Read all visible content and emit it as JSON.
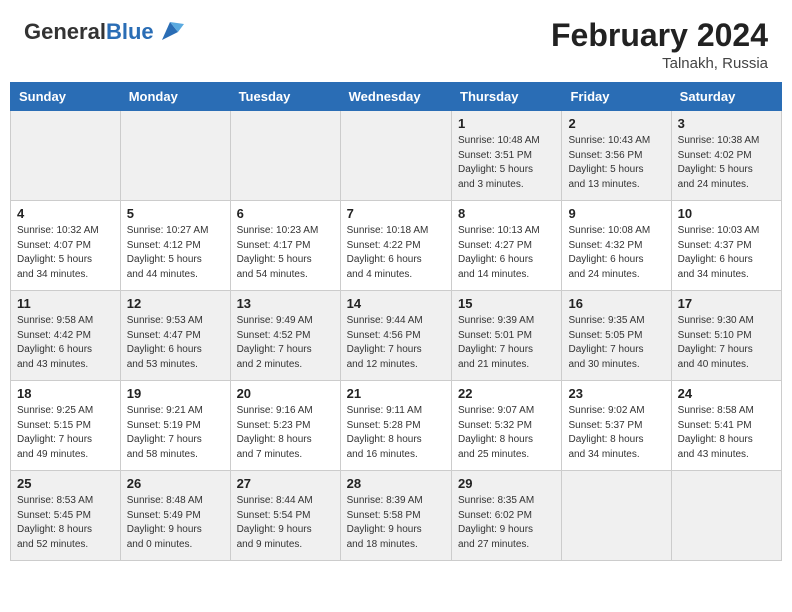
{
  "header": {
    "logo_general": "General",
    "logo_blue": "Blue",
    "month_year": "February 2024",
    "location": "Talnakh, Russia"
  },
  "weekdays": [
    "Sunday",
    "Monday",
    "Tuesday",
    "Wednesday",
    "Thursday",
    "Friday",
    "Saturday"
  ],
  "weeks": [
    [
      {
        "day": "",
        "info": ""
      },
      {
        "day": "",
        "info": ""
      },
      {
        "day": "",
        "info": ""
      },
      {
        "day": "",
        "info": ""
      },
      {
        "day": "1",
        "info": "Sunrise: 10:48 AM\nSunset: 3:51 PM\nDaylight: 5 hours\nand 3 minutes."
      },
      {
        "day": "2",
        "info": "Sunrise: 10:43 AM\nSunset: 3:56 PM\nDaylight: 5 hours\nand 13 minutes."
      },
      {
        "day": "3",
        "info": "Sunrise: 10:38 AM\nSunset: 4:02 PM\nDaylight: 5 hours\nand 24 minutes."
      }
    ],
    [
      {
        "day": "4",
        "info": "Sunrise: 10:32 AM\nSunset: 4:07 PM\nDaylight: 5 hours\nand 34 minutes."
      },
      {
        "day": "5",
        "info": "Sunrise: 10:27 AM\nSunset: 4:12 PM\nDaylight: 5 hours\nand 44 minutes."
      },
      {
        "day": "6",
        "info": "Sunrise: 10:23 AM\nSunset: 4:17 PM\nDaylight: 5 hours\nand 54 minutes."
      },
      {
        "day": "7",
        "info": "Sunrise: 10:18 AM\nSunset: 4:22 PM\nDaylight: 6 hours\nand 4 minutes."
      },
      {
        "day": "8",
        "info": "Sunrise: 10:13 AM\nSunset: 4:27 PM\nDaylight: 6 hours\nand 14 minutes."
      },
      {
        "day": "9",
        "info": "Sunrise: 10:08 AM\nSunset: 4:32 PM\nDaylight: 6 hours\nand 24 minutes."
      },
      {
        "day": "10",
        "info": "Sunrise: 10:03 AM\nSunset: 4:37 PM\nDaylight: 6 hours\nand 34 minutes."
      }
    ],
    [
      {
        "day": "11",
        "info": "Sunrise: 9:58 AM\nSunset: 4:42 PM\nDaylight: 6 hours\nand 43 minutes."
      },
      {
        "day": "12",
        "info": "Sunrise: 9:53 AM\nSunset: 4:47 PM\nDaylight: 6 hours\nand 53 minutes."
      },
      {
        "day": "13",
        "info": "Sunrise: 9:49 AM\nSunset: 4:52 PM\nDaylight: 7 hours\nand 2 minutes."
      },
      {
        "day": "14",
        "info": "Sunrise: 9:44 AM\nSunset: 4:56 PM\nDaylight: 7 hours\nand 12 minutes."
      },
      {
        "day": "15",
        "info": "Sunrise: 9:39 AM\nSunset: 5:01 PM\nDaylight: 7 hours\nand 21 minutes."
      },
      {
        "day": "16",
        "info": "Sunrise: 9:35 AM\nSunset: 5:05 PM\nDaylight: 7 hours\nand 30 minutes."
      },
      {
        "day": "17",
        "info": "Sunrise: 9:30 AM\nSunset: 5:10 PM\nDaylight: 7 hours\nand 40 minutes."
      }
    ],
    [
      {
        "day": "18",
        "info": "Sunrise: 9:25 AM\nSunset: 5:15 PM\nDaylight: 7 hours\nand 49 minutes."
      },
      {
        "day": "19",
        "info": "Sunrise: 9:21 AM\nSunset: 5:19 PM\nDaylight: 7 hours\nand 58 minutes."
      },
      {
        "day": "20",
        "info": "Sunrise: 9:16 AM\nSunset: 5:23 PM\nDaylight: 8 hours\nand 7 minutes."
      },
      {
        "day": "21",
        "info": "Sunrise: 9:11 AM\nSunset: 5:28 PM\nDaylight: 8 hours\nand 16 minutes."
      },
      {
        "day": "22",
        "info": "Sunrise: 9:07 AM\nSunset: 5:32 PM\nDaylight: 8 hours\nand 25 minutes."
      },
      {
        "day": "23",
        "info": "Sunrise: 9:02 AM\nSunset: 5:37 PM\nDaylight: 8 hours\nand 34 minutes."
      },
      {
        "day": "24",
        "info": "Sunrise: 8:58 AM\nSunset: 5:41 PM\nDaylight: 8 hours\nand 43 minutes."
      }
    ],
    [
      {
        "day": "25",
        "info": "Sunrise: 8:53 AM\nSunset: 5:45 PM\nDaylight: 8 hours\nand 52 minutes."
      },
      {
        "day": "26",
        "info": "Sunrise: 8:48 AM\nSunset: 5:49 PM\nDaylight: 9 hours\nand 0 minutes."
      },
      {
        "day": "27",
        "info": "Sunrise: 8:44 AM\nSunset: 5:54 PM\nDaylight: 9 hours\nand 9 minutes."
      },
      {
        "day": "28",
        "info": "Sunrise: 8:39 AM\nSunset: 5:58 PM\nDaylight: 9 hours\nand 18 minutes."
      },
      {
        "day": "29",
        "info": "Sunrise: 8:35 AM\nSunset: 6:02 PM\nDaylight: 9 hours\nand 27 minutes."
      },
      {
        "day": "",
        "info": ""
      },
      {
        "day": "",
        "info": ""
      }
    ]
  ]
}
